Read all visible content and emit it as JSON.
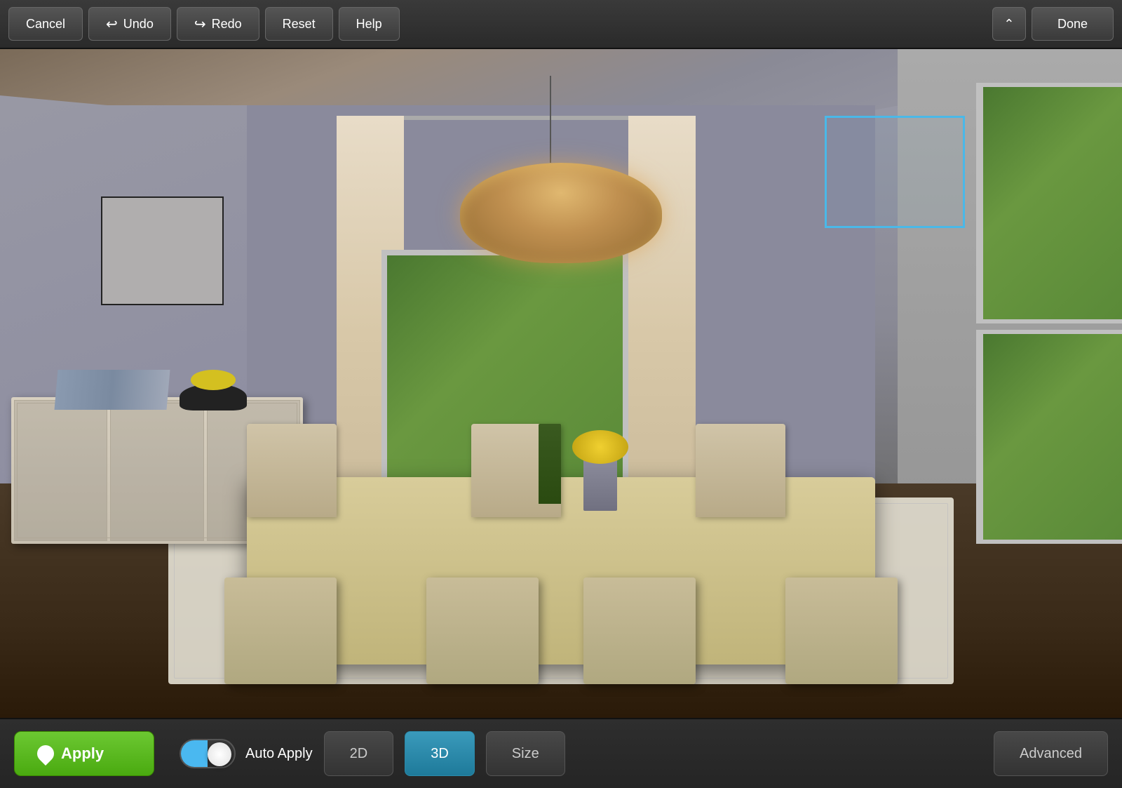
{
  "toolbar": {
    "cancel_label": "Cancel",
    "undo_label": "Undo",
    "redo_label": "Redo",
    "reset_label": "Reset",
    "help_label": "Help",
    "done_label": "Done"
  },
  "bottom_bar": {
    "apply_label": "Apply",
    "auto_apply_label": "Auto Apply",
    "mode_2d_label": "2D",
    "mode_3d_label": "3D",
    "size_label": "Size",
    "advanced_label": "Advanced"
  },
  "scene": {
    "selection_box_visible": true
  },
  "colors": {
    "apply_green": "#5cb830",
    "active_blue": "#2a8fb0",
    "toolbar_bg": "#333333",
    "toggle_blue": "#4ab8f0"
  }
}
